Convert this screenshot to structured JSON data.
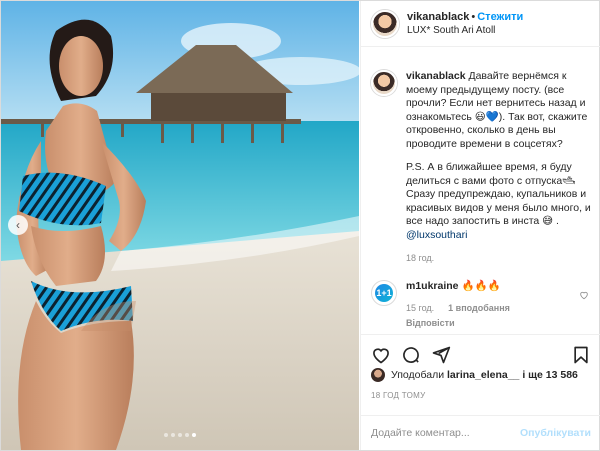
{
  "post": {
    "username": "vikanablack",
    "follow_label": "Стежити",
    "location": "LUX* South Ari Atoll"
  },
  "caption": {
    "username": "vikanablack",
    "text1": "Давайте вернёмся к моему предыдущему посту. (все прочли? Если нет вернитесь назад и ознакомьтесь 😃💙). Так вот, скажите откровенно, сколько в день вы проводите времени в соцсетях?",
    "text2": "P.S. А в ближайшее время, я буду делиться с вами фото с отпуска🛥 Сразу предупреждаю, купальников и красивых видов у меня было много, и все надо запостить в инста 😅 .",
    "mention": "@luxsouthari",
    "time": "18 год."
  },
  "comment": {
    "username": "m1ukraine",
    "text": "🔥🔥🔥",
    "time": "15 год.",
    "likes": "1 вподобання",
    "reply": "Відповісти"
  },
  "likes": {
    "prefix": "Уподобали",
    "user": "larina_elena__",
    "suffix": "і ще 13 586"
  },
  "posted_ago": "18 ГОД ТОМУ",
  "add_comment": {
    "placeholder": "Додайте коментар...",
    "publish": "Опублікувати"
  },
  "icons": [
    "heart-icon",
    "comment-icon",
    "share-icon",
    "bookmark-icon",
    "chevron-left-icon"
  ],
  "carousel": {
    "count": 5,
    "active": 5
  }
}
